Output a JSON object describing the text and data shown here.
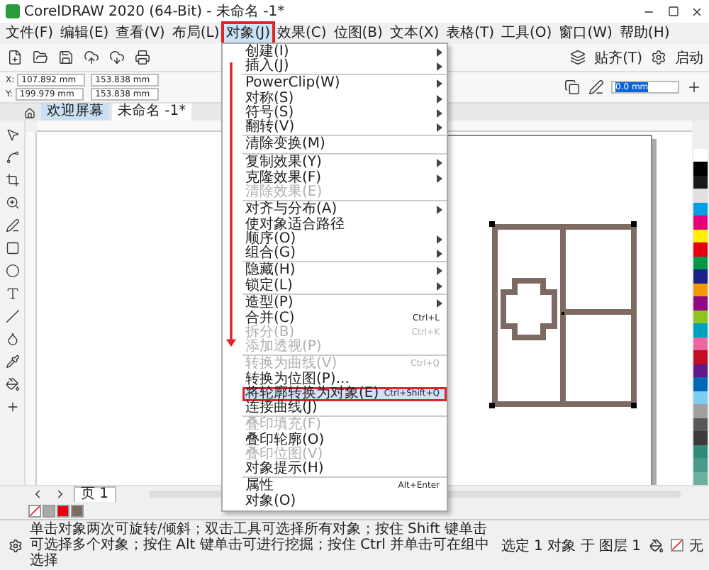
{
  "window": {
    "title": "CorelDRAW 2020 (64-Bit) - 未命名 -1*"
  },
  "menubar": [
    {
      "label": "文件(F)",
      "selected": false
    },
    {
      "label": "编辑(E)",
      "selected": false
    },
    {
      "label": "查看(V)",
      "selected": false
    },
    {
      "label": "布局(L)",
      "selected": false
    },
    {
      "label": "对象(J)",
      "selected": true
    },
    {
      "label": "效果(C)",
      "selected": false
    },
    {
      "label": "位图(B)",
      "selected": false
    },
    {
      "label": "文本(X)",
      "selected": false
    },
    {
      "label": "表格(T)",
      "selected": false
    },
    {
      "label": "工具(O)",
      "selected": false
    },
    {
      "label": "窗口(W)",
      "selected": false
    },
    {
      "label": "帮助(H)",
      "selected": false
    }
  ],
  "toolbar": {
    "snap": "贴齐(T)",
    "launch": "启动"
  },
  "property_bar": {
    "x_label": "X:",
    "y_label": "Y:",
    "x": "107.892 mm",
    "y": "199.979 mm",
    "width": "153.838 mm",
    "height": "153.838 mm",
    "outline_width": "0.0 mm"
  },
  "doc_tabs": [
    {
      "label": "欢迎屏幕",
      "selected": false
    },
    {
      "label": "未命名 -1*",
      "selected": true
    }
  ],
  "menu": {
    "items": [
      {
        "label": "创建(I)",
        "submenu": true,
        "disabled": false,
        "selected": false,
        "separator_before": false
      },
      {
        "label": "插入(J)",
        "submenu": true,
        "disabled": false,
        "selected": false,
        "separator_before": false
      },
      {
        "label": "PowerClip(W)",
        "submenu": true,
        "disabled": false,
        "selected": false,
        "separator_before": true
      },
      {
        "label": "对称(S)",
        "submenu": true,
        "disabled": false,
        "selected": false,
        "separator_before": false
      },
      {
        "label": "符号(S)",
        "submenu": true,
        "disabled": false,
        "selected": false,
        "separator_before": false
      },
      {
        "label": "翻转(V)",
        "submenu": true,
        "disabled": false,
        "selected": false,
        "separator_before": false
      },
      {
        "label": "清除变换(M)",
        "submenu": false,
        "disabled": false,
        "selected": false,
        "separator_before": true
      },
      {
        "label": "复制效果(Y)",
        "submenu": true,
        "disabled": false,
        "selected": false,
        "separator_before": true
      },
      {
        "label": "克隆效果(F)",
        "submenu": true,
        "disabled": false,
        "selected": false,
        "separator_before": false
      },
      {
        "label": "清除效果(E)",
        "submenu": false,
        "disabled": true,
        "selected": false,
        "separator_before": false
      },
      {
        "label": "对齐与分布(A)",
        "submenu": true,
        "disabled": false,
        "selected": false,
        "separator_before": true
      },
      {
        "label": "使对象适合路径",
        "submenu": false,
        "disabled": false,
        "selected": false,
        "separator_before": false
      },
      {
        "label": "顺序(O)",
        "submenu": true,
        "disabled": false,
        "selected": false,
        "separator_before": false
      },
      {
        "label": "组合(G)",
        "submenu": true,
        "disabled": false,
        "selected": false,
        "separator_before": false
      },
      {
        "label": "隐藏(H)",
        "submenu": true,
        "disabled": false,
        "selected": false,
        "separator_before": true
      },
      {
        "label": "锁定(L)",
        "submenu": true,
        "disabled": false,
        "selected": false,
        "separator_before": false
      },
      {
        "label": "造型(P)",
        "submenu": true,
        "disabled": false,
        "selected": false,
        "separator_before": true
      },
      {
        "label": "合并(C)",
        "shortcut": "Ctrl+L",
        "submenu": false,
        "disabled": false,
        "selected": false,
        "separator_before": false
      },
      {
        "label": "拆分(B)",
        "shortcut": "Ctrl+K",
        "submenu": false,
        "disabled": true,
        "selected": false,
        "separator_before": false
      },
      {
        "label": "添加透视(P)",
        "submenu": false,
        "disabled": true,
        "selected": false,
        "separator_before": false
      },
      {
        "label": "转换为曲线(V)",
        "shortcut": "Ctrl+Q",
        "submenu": false,
        "disabled": true,
        "selected": false,
        "separator_before": true
      },
      {
        "label": "转换为位图(P)...",
        "submenu": false,
        "disabled": false,
        "selected": false,
        "separator_before": false
      },
      {
        "label": "将轮廓转换为对象(E)",
        "shortcut": "Ctrl+Shift+Q",
        "submenu": false,
        "disabled": false,
        "selected": true,
        "separator_before": false
      },
      {
        "label": "连接曲线(J)",
        "submenu": false,
        "disabled": false,
        "selected": false,
        "separator_before": false
      },
      {
        "label": "叠印填充(F)",
        "submenu": false,
        "disabled": true,
        "selected": false,
        "separator_before": true
      },
      {
        "label": "叠印轮廓(O)",
        "submenu": false,
        "disabled": false,
        "selected": false,
        "separator_before": false
      },
      {
        "label": "叠印位图(V)",
        "submenu": false,
        "disabled": true,
        "selected": false,
        "separator_before": false
      },
      {
        "label": "对象提示(H)",
        "submenu": false,
        "disabled": false,
        "selected": false,
        "separator_before": false
      },
      {
        "label": "属性",
        "shortcut": "Alt+Enter",
        "submenu": false,
        "disabled": false,
        "selected": false,
        "separator_before": true
      },
      {
        "label": "对象(O)",
        "submenu": false,
        "disabled": false,
        "selected": false,
        "separator_before": false
      }
    ]
  },
  "palette": [
    {
      "color": "#ffffff"
    },
    {
      "color": "#000000"
    },
    {
      "color": "#1a1a1a"
    },
    {
      "color": "#e0e0e0"
    },
    {
      "color": "#00a0e9"
    },
    {
      "color": "#e4007f"
    },
    {
      "color": "#fff100"
    },
    {
      "color": "#e60012"
    },
    {
      "color": "#009944"
    },
    {
      "color": "#1d2088"
    },
    {
      "color": "#f39800"
    },
    {
      "color": "#920783"
    },
    {
      "color": "#8fc31f"
    },
    {
      "color": "#00a0c1"
    },
    {
      "color": "#ea68a2"
    },
    {
      "color": "#c30d23"
    },
    {
      "color": "#601986"
    },
    {
      "color": "#0068b7"
    },
    {
      "color": "#7ecef4"
    },
    {
      "color": "#a0a0a0"
    },
    {
      "color": "#595757"
    },
    {
      "color": "#3e3a39"
    },
    {
      "color": "#2e8b7a"
    },
    {
      "color": "#4a9a8a"
    },
    {
      "color": "#6ab0a0"
    }
  ],
  "document_palette": [
    {
      "color": "#a9a9a9"
    },
    {
      "color": "#e60012"
    },
    {
      "color": "#7d6b63"
    }
  ],
  "page_tabs": [
    {
      "label": "页 1"
    }
  ],
  "status_bar": {
    "hint": "单击对象两次可旋转/倾斜；双击工具可选择所有对象；按住 Shift 键单击可选择多个对象；按住 Alt 键单击可进行挖掘；按住 Ctrl 并单击可在组中选择",
    "selection": "选定 1 对象 于 图层 1",
    "outline": "无"
  }
}
